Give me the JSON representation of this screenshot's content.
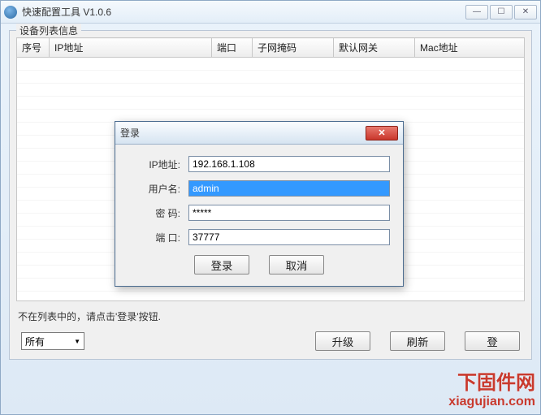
{
  "window": {
    "title": "快速配置工具 V1.0.6"
  },
  "fieldset": {
    "title": "设备列表信息"
  },
  "table": {
    "columns": {
      "seq": "序号",
      "ip": "IP地址",
      "port": "端口",
      "subnet": "子网掩码",
      "gateway": "默认网关",
      "mac": "Mac地址"
    }
  },
  "hint": "不在列表中的，请点击'登录'按钮.",
  "filter": {
    "selected": "所有"
  },
  "buttons": {
    "upgrade": "升级",
    "refresh": "刷新",
    "login_main": "登"
  },
  "dialog": {
    "title": "登录",
    "labels": {
      "ip": "IP地址:",
      "user": "用户名:",
      "pass": "密 码:",
      "port": "端 口:"
    },
    "values": {
      "ip": "192.168.1.108",
      "user": "admin",
      "pass": "*****",
      "port": "37777"
    },
    "buttons": {
      "login": "登录",
      "cancel": "取消"
    }
  },
  "watermark": {
    "line1": "下固件网",
    "line2": "xiagujian.com"
  }
}
